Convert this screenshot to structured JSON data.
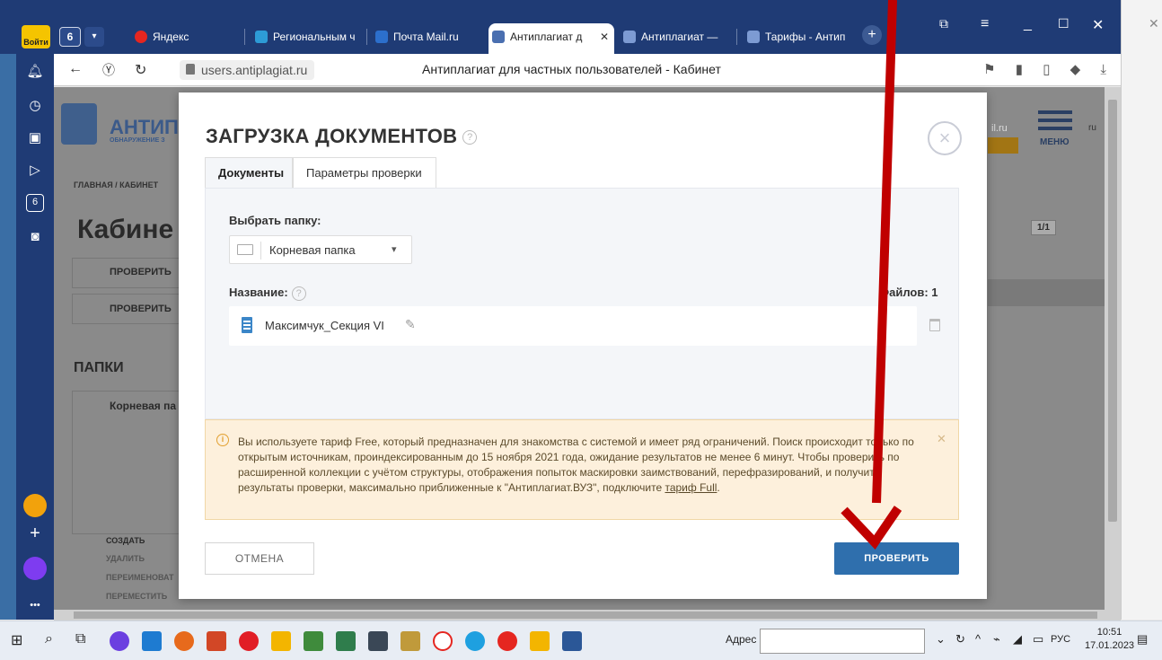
{
  "browser": {
    "login_label": "Войти",
    "tab_count": "6",
    "tabs": [
      {
        "label": "Яндекс"
      },
      {
        "label": "Региональным ч"
      },
      {
        "label": "Почта Mail.ru"
      },
      {
        "label": "Антиплагиат д"
      },
      {
        "label": "Антиплагиат — "
      },
      {
        "label": "Тарифы - Антип"
      }
    ],
    "url": "users.antiplagiat.ru",
    "page_title": "Антиплагиат для частных пользователей - Кабинет"
  },
  "sidebar_counter": "6",
  "page_bg": {
    "logo": "АНТИПЛ",
    "logo_sub": "ОБНАРУЖЕНИЕ З",
    "breadcrumb": "ГЛАВНАЯ / КАБИНЕТ",
    "heading": "Кабине",
    "check1": "ПРОВЕРИТЬ",
    "check2": "ПРОВЕРИТЬ",
    "folders": "ПАПКИ",
    "root_folder": "Корневая па",
    "create": "СОЗДАТЬ",
    "delete": "УДАЛИТЬ",
    "rename": "ПЕРЕИМЕНОВАТ",
    "move": "ПЕРЕМЕСТИТЬ",
    "menu": "МЕНЮ",
    "mail": "il.ru",
    "lang": "ru",
    "pager": "1/1"
  },
  "modal": {
    "title": "ЗАГРУЗКА ДОКУМЕНТОВ",
    "help": "?",
    "tabs": [
      "Документы",
      "Параметры проверки"
    ],
    "folder_label": "Выбрать папку:",
    "folder_value": "Корневая папка",
    "name_label": "Название:",
    "files_count": "Файлов: 1",
    "file_name": "Максимчук_Секция VI",
    "warning_text": "Вы используете тариф Free, который предназначен для знакомства с системой и имеет ряд ограничений. Поиск происходит только по открытым источникам, проиндексированным до 15 ноября 2021 года, ожидание результатов не менее 6 минут. Чтобы проверить по расширенной коллекции с учётом структуры, отображения попыток маскировки заимствований, перефразирований, и получить результаты проверки, максимально приближенные к \"Антиплагиат.ВУЗ\", подключите ",
    "warning_link": "тариф Full",
    "warning_end": ".",
    "cancel": "ОТМЕНА",
    "check": "ПРОВЕРИТЬ"
  },
  "taskbar": {
    "address_label": "Адрес",
    "lang": "РУС",
    "time": "10:51",
    "date": "17.01.2023"
  },
  "colors": {
    "accent": "#2f6fad",
    "browser_bar": "#1f3b75",
    "annotation_arrow": "#c00000"
  }
}
